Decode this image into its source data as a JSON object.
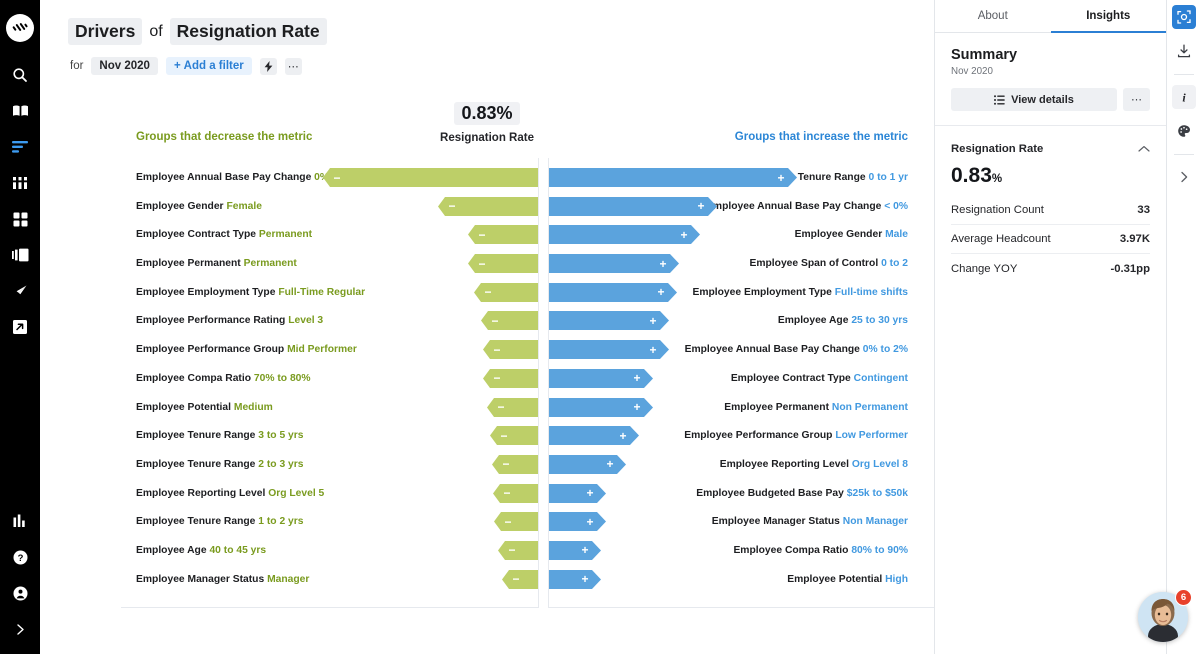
{
  "sidebar": {
    "logo": "logo-mark",
    "items": [
      {
        "icon": "search-icon",
        "active": false
      },
      {
        "icon": "book-icon",
        "active": false
      },
      {
        "icon": "bars-icon",
        "active": true
      },
      {
        "icon": "columns-icon",
        "active": false
      },
      {
        "icon": "grid-icon",
        "active": false
      },
      {
        "icon": "panels-icon",
        "active": false
      },
      {
        "icon": "compass-icon",
        "active": false
      },
      {
        "icon": "external-link-icon",
        "active": false
      }
    ],
    "bottom_items": [
      {
        "icon": "bar-chart-icon"
      },
      {
        "icon": "help-icon"
      },
      {
        "icon": "account-icon"
      },
      {
        "icon": "chevron-right-icon"
      }
    ]
  },
  "header": {
    "title_word_1": "Drivers",
    "title_connector": "of",
    "title_word_2": "Resignation Rate",
    "for_label": "for",
    "date_chip": "Nov 2020",
    "add_filter": "Add a filter",
    "add_filter_plus": "+",
    "lightning_icon": "lightning-icon",
    "more_icon": "ellipsis-icon"
  },
  "chart_data": {
    "type": "bar",
    "title": "Drivers of Resignation Rate",
    "subtitle": "Nov 2020",
    "metric_value": "0.83%",
    "metric_label": "Resignation Rate",
    "legend_left": "Groups that decrease the metric",
    "legend_right": "Groups that increase the metric",
    "colors": {
      "decrease": "#bdcf68",
      "increase": "#5ba3dd",
      "legend_left": "#7a9b1f",
      "legend_right": "#2b86d6"
    },
    "series": [
      {
        "name": "Groups that decrease the metric",
        "direction": "decrease",
        "color": "#bdcf68",
        "items": [
          {
            "attribute": "Employee Annual Base Pay Change",
            "value": "0%",
            "length": 215
          },
          {
            "attribute": "Employee Gender",
            "value": "Female",
            "length": 100
          },
          {
            "attribute": "Employee Contract Type",
            "value": "Permanent",
            "length": 70
          },
          {
            "attribute": "Employee Permanent",
            "value": "Permanent",
            "length": 70
          },
          {
            "attribute": "Employee Employment Type",
            "value": "Full-Time Regular",
            "length": 64
          },
          {
            "attribute": "Employee Performance Rating",
            "value": "Level 3",
            "length": 57
          },
          {
            "attribute": "Employee Performance Group",
            "value": "Mid Performer",
            "length": 55
          },
          {
            "attribute": "Employee Compa Ratio",
            "value": "70% to 80%",
            "length": 55
          },
          {
            "attribute": "Employee Potential",
            "value": "Medium",
            "length": 51
          },
          {
            "attribute": "Employee Tenure Range",
            "value": "3 to 5 yrs",
            "length": 48
          },
          {
            "attribute": "Employee Tenure Range",
            "value": "2 to 3 yrs",
            "length": 46
          },
          {
            "attribute": "Employee Reporting Level",
            "value": "Org Level 5",
            "length": 45
          },
          {
            "attribute": "Employee Tenure Range",
            "value": "1 to 2 yrs",
            "length": 44
          },
          {
            "attribute": "Employee Age",
            "value": "40 to 45 yrs",
            "length": 40
          },
          {
            "attribute": "Employee Manager Status",
            "value": "Manager",
            "length": 36
          }
        ]
      },
      {
        "name": "Groups that increase the metric",
        "direction": "increase",
        "color": "#5ba3dd",
        "items": [
          {
            "attribute": "Employee Tenure Range",
            "value": "0 to 1 yr",
            "length": 248
          },
          {
            "attribute": "Employee Annual Base Pay Change",
            "value": "< 0%",
            "length": 168
          },
          {
            "attribute": "Employee Gender",
            "value": "Male",
            "length": 151
          },
          {
            "attribute": "Employee Span of Control",
            "value": "0 to 2",
            "length": 130
          },
          {
            "attribute": "Employee Employment Type",
            "value": "Full-time shifts",
            "length": 128
          },
          {
            "attribute": "Employee Age",
            "value": "25 to 30 yrs",
            "length": 120
          },
          {
            "attribute": "Employee Annual Base Pay Change",
            "value": "0% to 2%",
            "length": 120
          },
          {
            "attribute": "Employee Contract Type",
            "value": "Contingent",
            "length": 104
          },
          {
            "attribute": "Employee Permanent",
            "value": "Non Permanent",
            "length": 104
          },
          {
            "attribute": "Employee Performance Group",
            "value": "Low Performer",
            "length": 90
          },
          {
            "attribute": "Employee Reporting Level",
            "value": "Org Level 8",
            "length": 77
          },
          {
            "attribute": "Employee Budgeted Base Pay",
            "value": "$25k to $50k",
            "length": 57
          },
          {
            "attribute": "Employee Manager Status",
            "value": "Non Manager",
            "length": 57
          },
          {
            "attribute": "Employee Compa Ratio",
            "value": "80% to 90%",
            "length": 52
          },
          {
            "attribute": "Employee Potential",
            "value": "High",
            "length": 52
          }
        ]
      }
    ]
  },
  "panel": {
    "tabs": [
      {
        "label": "About",
        "active": false
      },
      {
        "label": "Insights",
        "active": true
      }
    ],
    "summary_title": "Summary",
    "summary_sub": "Nov 2020",
    "view_details": "View details",
    "view_details_icon": "list-icon",
    "more_icon": "ellipsis-icon",
    "kpi_name": "Resignation Rate",
    "collapse_icon": "chevron-up-icon",
    "kpi_value": "0.83",
    "kpi_unit": "%",
    "rows": [
      {
        "label": "Resignation Count",
        "value": "33"
      },
      {
        "label": "Average Headcount",
        "value": "3.97K"
      },
      {
        "label": "Change YOY",
        "value": "-0.31pp"
      }
    ]
  },
  "iconrail": {
    "items": [
      {
        "icon": "focus-icon",
        "style": "primary"
      },
      {
        "icon": "download-icon",
        "style": "plain"
      },
      {
        "icon": "info-icon",
        "style": "soft"
      },
      {
        "icon": "palette-icon",
        "style": "plain"
      },
      {
        "icon": "chevron-right-icon",
        "style": "plain"
      }
    ]
  },
  "chat": {
    "badge_count": "6",
    "avatar": "support-agent-avatar"
  }
}
